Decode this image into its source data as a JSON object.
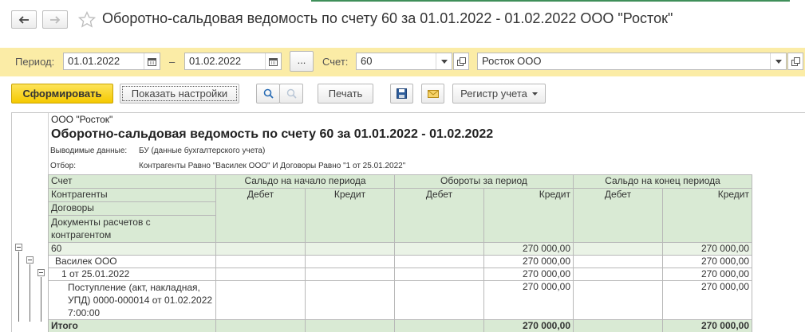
{
  "window": {
    "title": "Оборотно-сальдовая ведомость по счету 60 за 01.01.2022 - 01.02.2022 ООО \"Росток\""
  },
  "params": {
    "period_label": "Период:",
    "date_from": "01.01.2022",
    "dash": "–",
    "date_to": "01.02.2022",
    "dots_label": "...",
    "account_label": "Счет:",
    "account_value": "60",
    "org_value": "Росток ООО"
  },
  "toolbar": {
    "generate_label": "Сформировать",
    "settings_label": "Показать настройки",
    "print_label": "Печать",
    "register_label": "Регистр учета"
  },
  "report": {
    "org": "ООО \"Росток\"",
    "title": "Оборотно-сальдовая ведомость по счету 60 за 01.01.2022 - 01.02.2022",
    "output_label": "Выводимые данные:",
    "output_value": "БУ (данные бухгалтерского учета)",
    "filter_label": "Отбор:",
    "filter_value": "Контрагенты Равно \"Василек ООО\" И Договоры Равно \"1 от 25.01.2022\"",
    "headers": {
      "account": "Счет",
      "contractors": "Контрагенты",
      "contracts": "Договоры",
      "documents": "Документы расчетов с контрагентом",
      "opening": "Сальдо на начало периода",
      "turnover": "Обороты за период",
      "closing": "Сальдо на конец периода",
      "debit": "Дебет",
      "credit": "Кредит"
    },
    "rows": [
      {
        "name": "60",
        "turnover_credit": "270 000,00",
        "closing_credit": "270 000,00"
      },
      {
        "name": "Василек ООО",
        "turnover_credit": "270 000,00",
        "closing_credit": "270 000,00"
      },
      {
        "name": "1 от 25.01.2022",
        "turnover_credit": "270 000,00",
        "closing_credit": "270 000,00"
      },
      {
        "name": "Поступление (акт, накладная, УПД) 0000-000014 от 01.02.2022 7:00:00",
        "turnover_credit": "270 000,00",
        "closing_credit": "270 000,00"
      }
    ],
    "total": {
      "name": "Итого",
      "turnover_credit": "270 000,00",
      "closing_credit": "270 000,00"
    }
  },
  "icons": {
    "back": "arrow-left-icon",
    "forward": "arrow-right-icon",
    "favorite": "star-icon",
    "calendar": "calendar-icon",
    "dropdown": "chevron-down-icon",
    "open": "open-form-icon",
    "search": "search-icon",
    "search_clear": "search-clear-icon",
    "save": "floppy-disk-icon",
    "mail": "envelope-icon"
  },
  "colors": {
    "panel_bg": "#fbeca6",
    "primary_button": "#f5c900",
    "table_header_bg": "#d9ead4",
    "row_highlight": "#eaf3e6"
  }
}
